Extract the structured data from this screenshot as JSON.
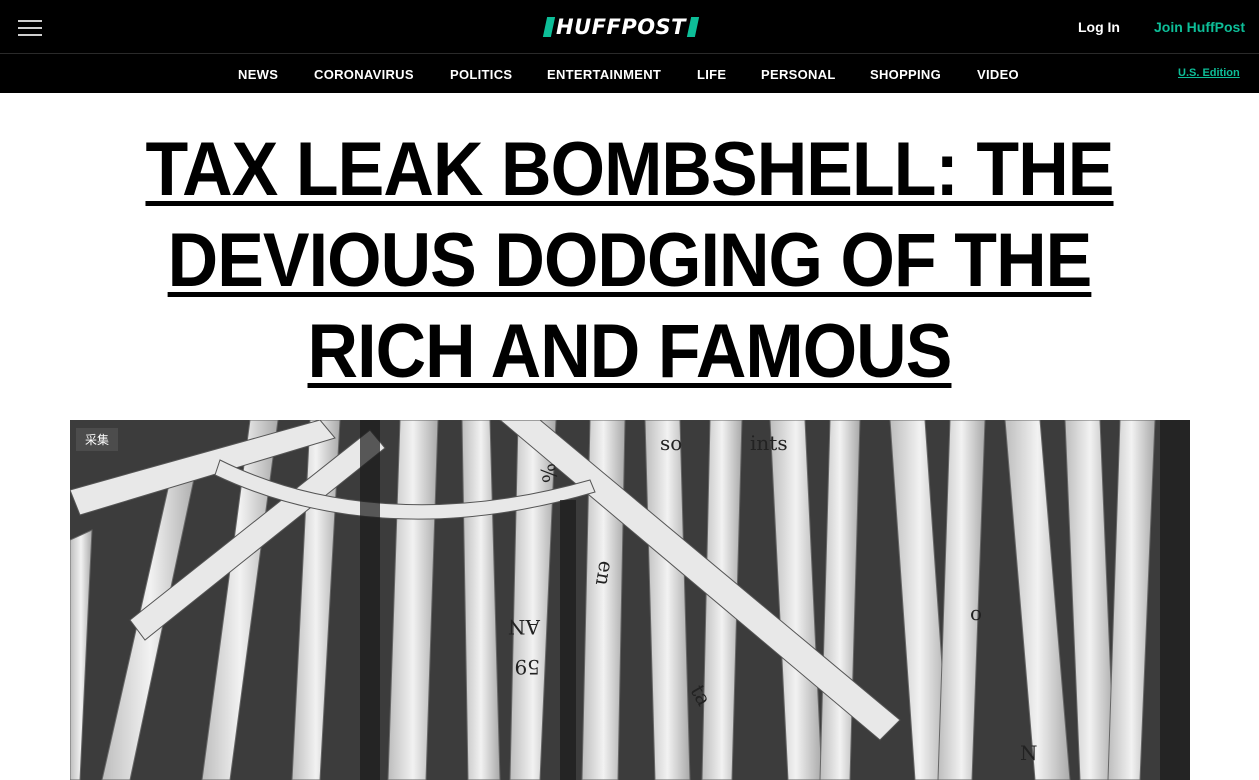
{
  "header": {
    "logo_text": "HUFFPOST",
    "login_label": "Log In",
    "join_label": "Join HuffPost",
    "menu_icon": "hamburger-menu-icon"
  },
  "nav": {
    "items": [
      "NEWS",
      "CORONAVIRUS",
      "POLITICS",
      "ENTERTAINMENT",
      "LIFE",
      "PERSONAL",
      "SHOPPING",
      "VIDEO"
    ],
    "edition_label": "U.S. Edition"
  },
  "article": {
    "headline": "TAX LEAK BOMBSHELL: THE DEVIOUS DODGING OF THE RICH AND FAMOUS",
    "image_badge": "采集",
    "image_subject": "shredded paper strips"
  },
  "colors": {
    "brand": "#0dbe98",
    "topbar": "#000000"
  }
}
